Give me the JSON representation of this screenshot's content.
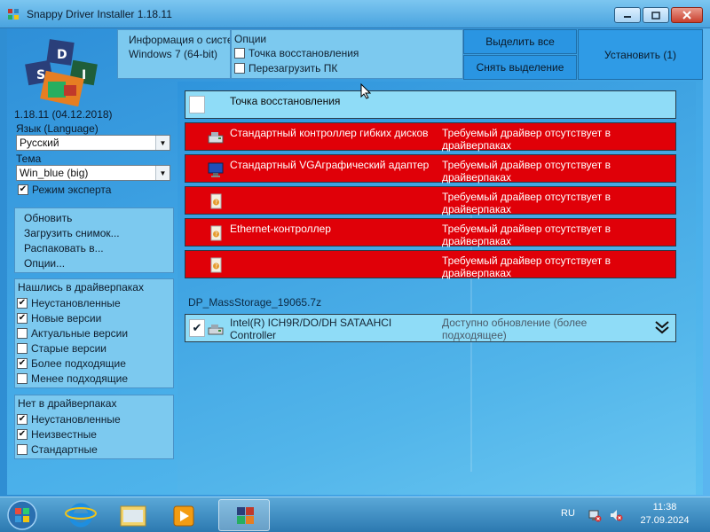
{
  "window": {
    "title": "Snappy Driver Installer 1.18.11"
  },
  "logo": {
    "letters": [
      "S",
      "D",
      "I"
    ],
    "version": "1.18.11 (04.12.2018)"
  },
  "topbar": {
    "info_line1": "Информация о системе",
    "info_line2": "Windows 7 (64-bit)",
    "options_header": "Опции",
    "options": [
      {
        "label": "Точка восстановления",
        "checked": false
      },
      {
        "label": "Перезагрузить ПК",
        "checked": false
      }
    ],
    "select_all": "Выделить все",
    "deselect": "Снять выделение",
    "install": "Установить (1)"
  },
  "settings": {
    "language_label": "Язык (Language)",
    "language_value": "Русский",
    "theme_label": "Тема",
    "theme_value": "Win_blue (big)",
    "expert_mode_label": "Режим эксперта",
    "expert_mode_checked": true
  },
  "actions": {
    "items": [
      "Обновить",
      "Загрузить снимок...",
      "Распаковать в...",
      "Опции..."
    ]
  },
  "found": {
    "header": "Нашлись в драйверпаках",
    "items": [
      {
        "label": "Неустановленные",
        "checked": true
      },
      {
        "label": "Новые версии",
        "checked": true
      },
      {
        "label": "Актуальные версии",
        "checked": false
      },
      {
        "label": "Старые версии",
        "checked": false
      },
      {
        "label": "Более подходящие",
        "checked": true
      },
      {
        "label": "Менее подходящие",
        "checked": false
      }
    ]
  },
  "notfound": {
    "header": "Нет в драйверпаках",
    "items": [
      {
        "label": "Неустановленные",
        "checked": true
      },
      {
        "label": "Неизвестные",
        "checked": true
      },
      {
        "label": "Стандартные",
        "checked": false
      }
    ]
  },
  "list": {
    "restore_row": "Точка восстановления",
    "missing": [
      {
        "name": "Стандартный контроллер гибких дисков",
        "status": "Требуемый драйвер отсутствует в драйверпаках",
        "icon": "floppy-controller-icon"
      },
      {
        "name": "Стандартный VGAграфический адаптер",
        "status": "Требуемый драйвер отсутствует в драйверпаках",
        "icon": "monitor-icon"
      },
      {
        "name": "",
        "status": "Требуемый драйвер отсутствует в драйверпаках",
        "icon": "unknown-device-icon"
      },
      {
        "name": "Ethernet-контроллер",
        "status": "Требуемый драйвер отсутствует в драйверпаках",
        "icon": "unknown-device-icon"
      },
      {
        "name": "",
        "status": "Требуемый драйвер отсутствует в драйверпаках",
        "icon": "unknown-device-icon"
      }
    ],
    "pack_title": "DP_MassStorage_19065.7z",
    "update": {
      "name_line1": "Intel(R) ICH9R/DO/DH SATAAHCI",
      "name_line2": "Controller",
      "status_line1": "Доступно обновление (более",
      "status_line2": "подходящее)",
      "checked": true
    }
  },
  "taskbar": {
    "lang": "RU",
    "time": "11:38",
    "date": "27.09.2024"
  },
  "colors": {
    "missing_row": "#e00008",
    "panel_bg": "#7cc9ef",
    "button_blue": "#2a95e2"
  }
}
